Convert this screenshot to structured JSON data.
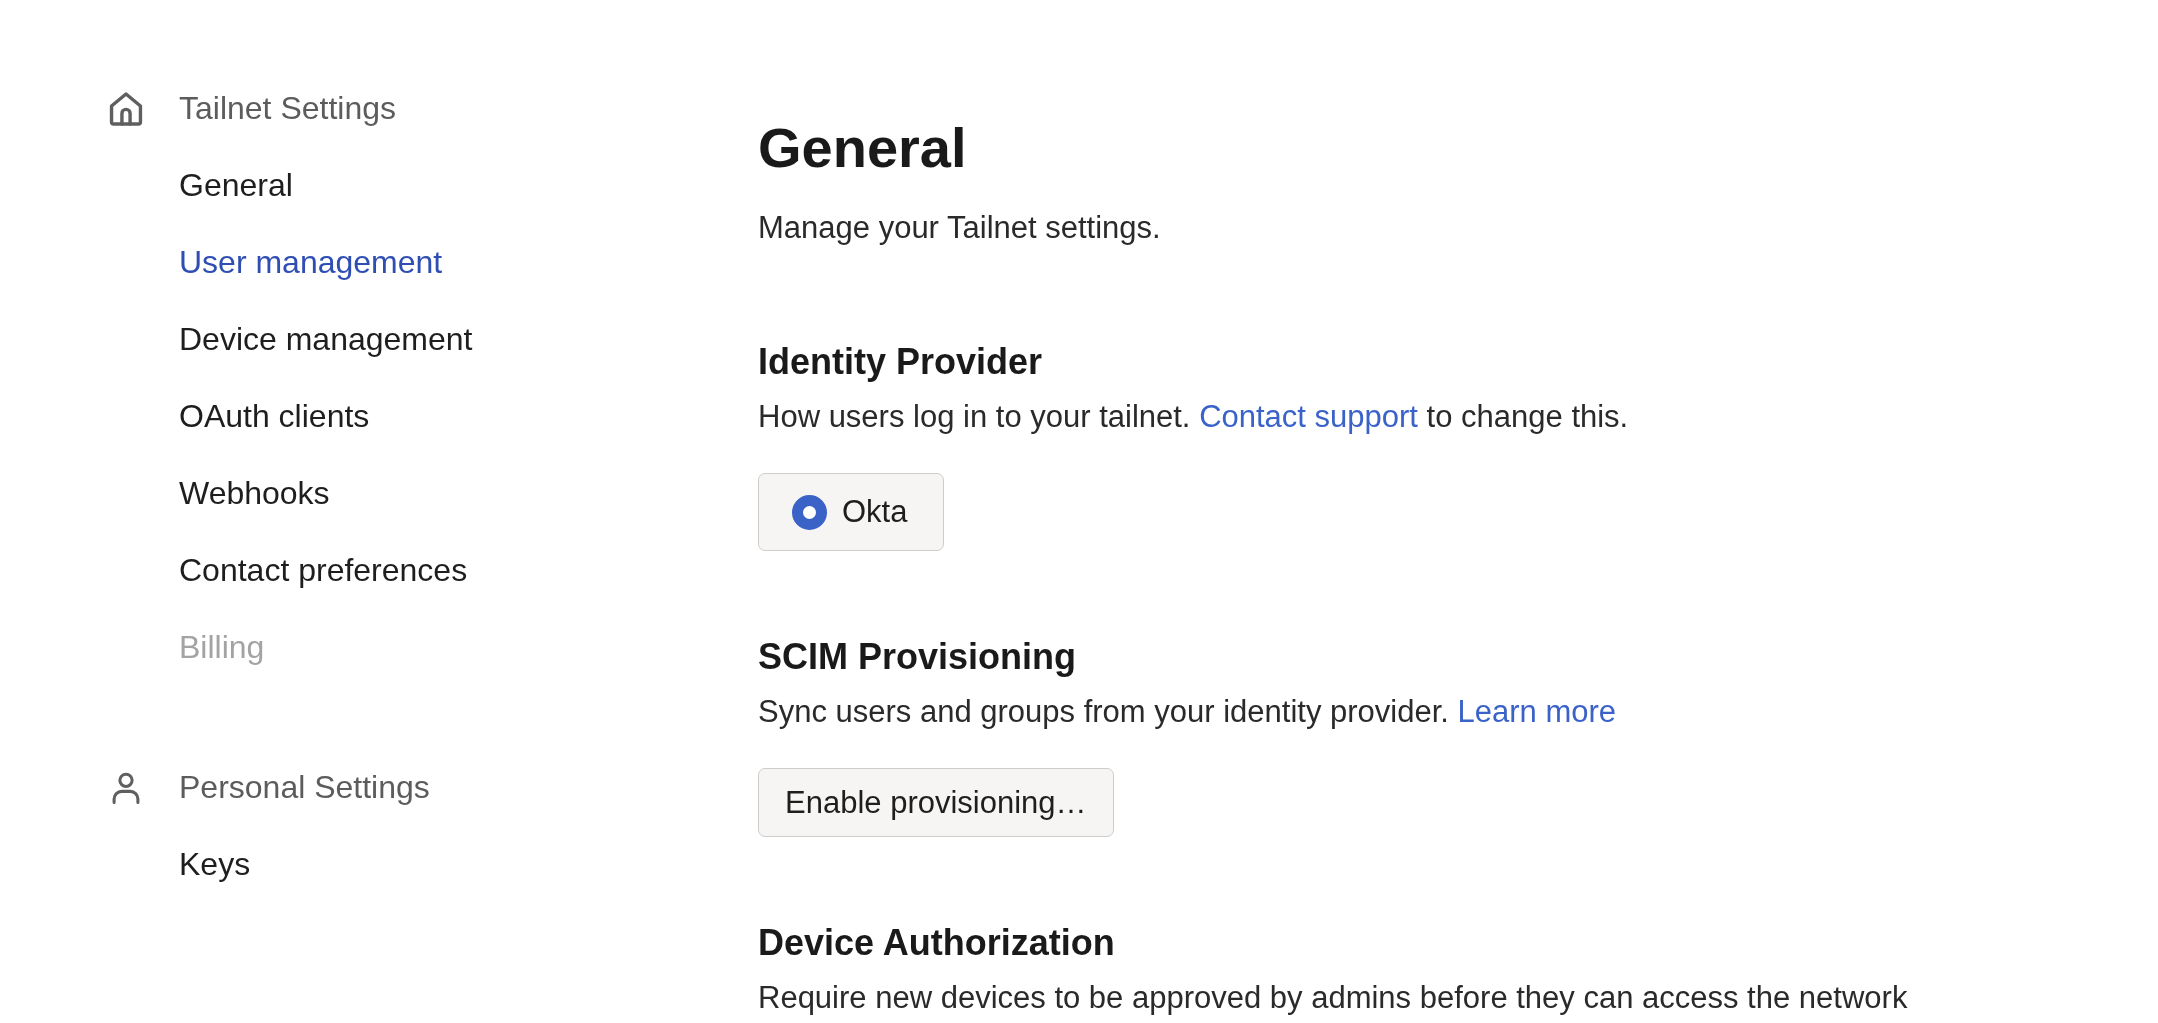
{
  "sidebar": {
    "groups": [
      {
        "title": "Tailnet Settings",
        "items": [
          {
            "label": "General",
            "selected": false,
            "disabled": false
          },
          {
            "label": "User management",
            "selected": true,
            "disabled": false
          },
          {
            "label": "Device management",
            "selected": false,
            "disabled": false
          },
          {
            "label": "OAuth clients",
            "selected": false,
            "disabled": false
          },
          {
            "label": "Webhooks",
            "selected": false,
            "disabled": false
          },
          {
            "label": "Contact preferences",
            "selected": false,
            "disabled": false
          },
          {
            "label": "Billing",
            "selected": false,
            "disabled": true
          }
        ]
      },
      {
        "title": "Personal Settings",
        "items": [
          {
            "label": "Keys",
            "selected": false,
            "disabled": false
          }
        ]
      }
    ]
  },
  "main": {
    "title": "General",
    "subtitle": "Manage your Tailnet settings.",
    "sections": [
      {
        "heading": "Identity Provider",
        "description": {
          "text": "How users log in to your tailnet.",
          "link": "Contact support",
          "after": "to change this."
        },
        "control": {
          "kind": "radio_group",
          "options": [
            {
              "label": "Okta",
              "selected": true
            }
          ]
        }
      },
      {
        "heading": "SCIM Provisioning",
        "description": {
          "text": "Sync users and groups from your identity provider.",
          "link": "Learn more"
        },
        "control": {
          "kind": "button",
          "label": "Enable provisioning…"
        }
      },
      {
        "heading": "Device Authorization",
        "description": {
          "text": "Require new devices to be approved by admins before they can access the network"
        }
      }
    ]
  }
}
